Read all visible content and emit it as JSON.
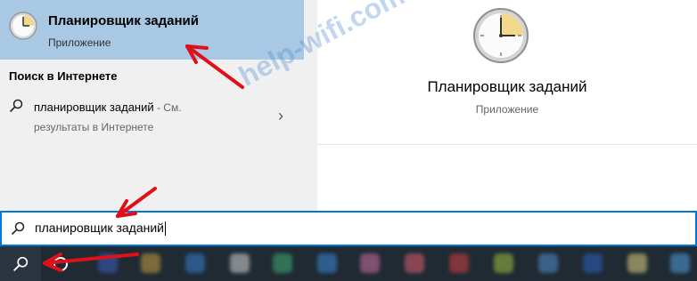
{
  "best_match": {
    "title": "Планировщик заданий",
    "subtitle": "Приложение",
    "icon": "clock-icon"
  },
  "web_section": {
    "heading": "Поиск в Интернете",
    "item": {
      "query": "планировщик заданий",
      "suffix": " - См.",
      "second_line": "результаты в Интернете"
    }
  },
  "preview": {
    "title": "Планировщик заданий",
    "subtitle": "Приложение",
    "icon": "clock-icon"
  },
  "search": {
    "value": "планировщик заданий"
  },
  "watermark": "help-wifi.com",
  "colors": {
    "selected": "#a8c8e4",
    "accent": "#0078d7",
    "arrow": "#e0101a",
    "taskbar": "#1f2a33"
  }
}
